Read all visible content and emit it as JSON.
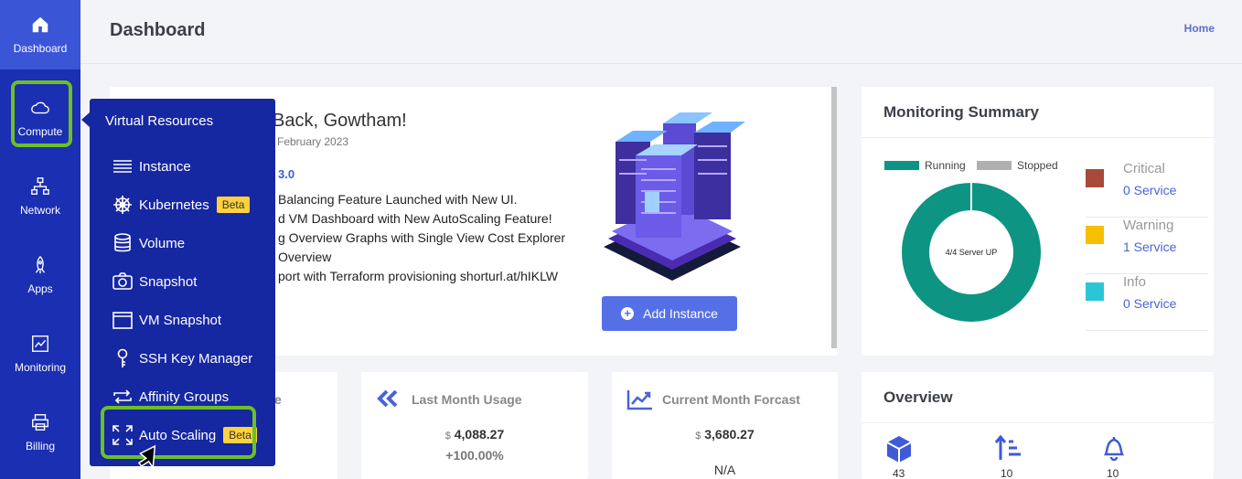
{
  "sidebar": {
    "items": [
      {
        "label": "Dashboard",
        "icon": "home-icon"
      },
      {
        "label": "Compute",
        "icon": "cloud-icon"
      },
      {
        "label": "Network",
        "icon": "network-icon"
      },
      {
        "label": "Apps",
        "icon": "rocket-icon"
      },
      {
        "label": "Monitoring",
        "icon": "chart-icon"
      },
      {
        "label": "Billing",
        "icon": "printer-icon"
      }
    ]
  },
  "header": {
    "title": "Dashboard",
    "breadcrumb": "Home"
  },
  "submenu": {
    "title": "Virtual Resources",
    "items": [
      {
        "label": "Instance",
        "icon": "list-icon"
      },
      {
        "label": "Kubernetes",
        "icon": "helm-icon",
        "badge": "Beta"
      },
      {
        "label": "Volume",
        "icon": "database-icon"
      },
      {
        "label": "Snapshot",
        "icon": "camera-icon"
      },
      {
        "label": "VM Snapshot",
        "icon": "window-icon"
      },
      {
        "label": "SSH Key Manager",
        "icon": "key-icon"
      },
      {
        "label": "Affinity Groups",
        "icon": "repeat-icon"
      },
      {
        "label": "Auto Scaling",
        "icon": "expand-icon",
        "badge": "Beta"
      }
    ]
  },
  "welcome": {
    "title": "Back, Gowtham!",
    "date": "February 2023",
    "version": "3.0",
    "notes": [
      "Balancing Feature Launched with New UI.",
      "d VM Dashboard with New AutoScaling Feature!",
      "g Overview Graphs with Single View Cost Explorer",
      "Overview",
      "port with Terraform provisioning shorturl.at/hIKLW"
    ],
    "add_button": "Add Instance"
  },
  "monitoring": {
    "title": "Monitoring Summary",
    "legend": [
      {
        "label": "Running",
        "color": "#0e9482"
      },
      {
        "label": "Stopped",
        "color": "#b0b0b0"
      }
    ],
    "donut_center": "4/4 Server UP",
    "running": 4,
    "total": 4,
    "statuses": [
      {
        "name": "Critical",
        "service": "0 Service",
        "color": "#a84a3a"
      },
      {
        "name": "Warning",
        "service": "1 Service",
        "color": "#f6c000"
      },
      {
        "name": "Info",
        "service": "0 Service",
        "color": "#2bc6d6"
      }
    ]
  },
  "stats": [
    {
      "title_fragment": "e"
    },
    {
      "title": "Last Month Usage",
      "currency": "$",
      "amount": "4,088.27",
      "change": "+100.00%"
    },
    {
      "title": "Current Month Forcast",
      "currency": "$",
      "amount": "3,680.27",
      "change": "N/A"
    }
  ],
  "overview": {
    "title": "Overview",
    "items": [
      {
        "icon": "cube-icon",
        "value": "43"
      },
      {
        "icon": "sort-icon",
        "value": "10"
      },
      {
        "icon": "bell-icon",
        "value": "10"
      }
    ]
  },
  "colors": {
    "sidebar": "#1a2fb2",
    "submenu": "#1627a2",
    "accent": "#5570e6",
    "highlight": "#6cc024"
  }
}
